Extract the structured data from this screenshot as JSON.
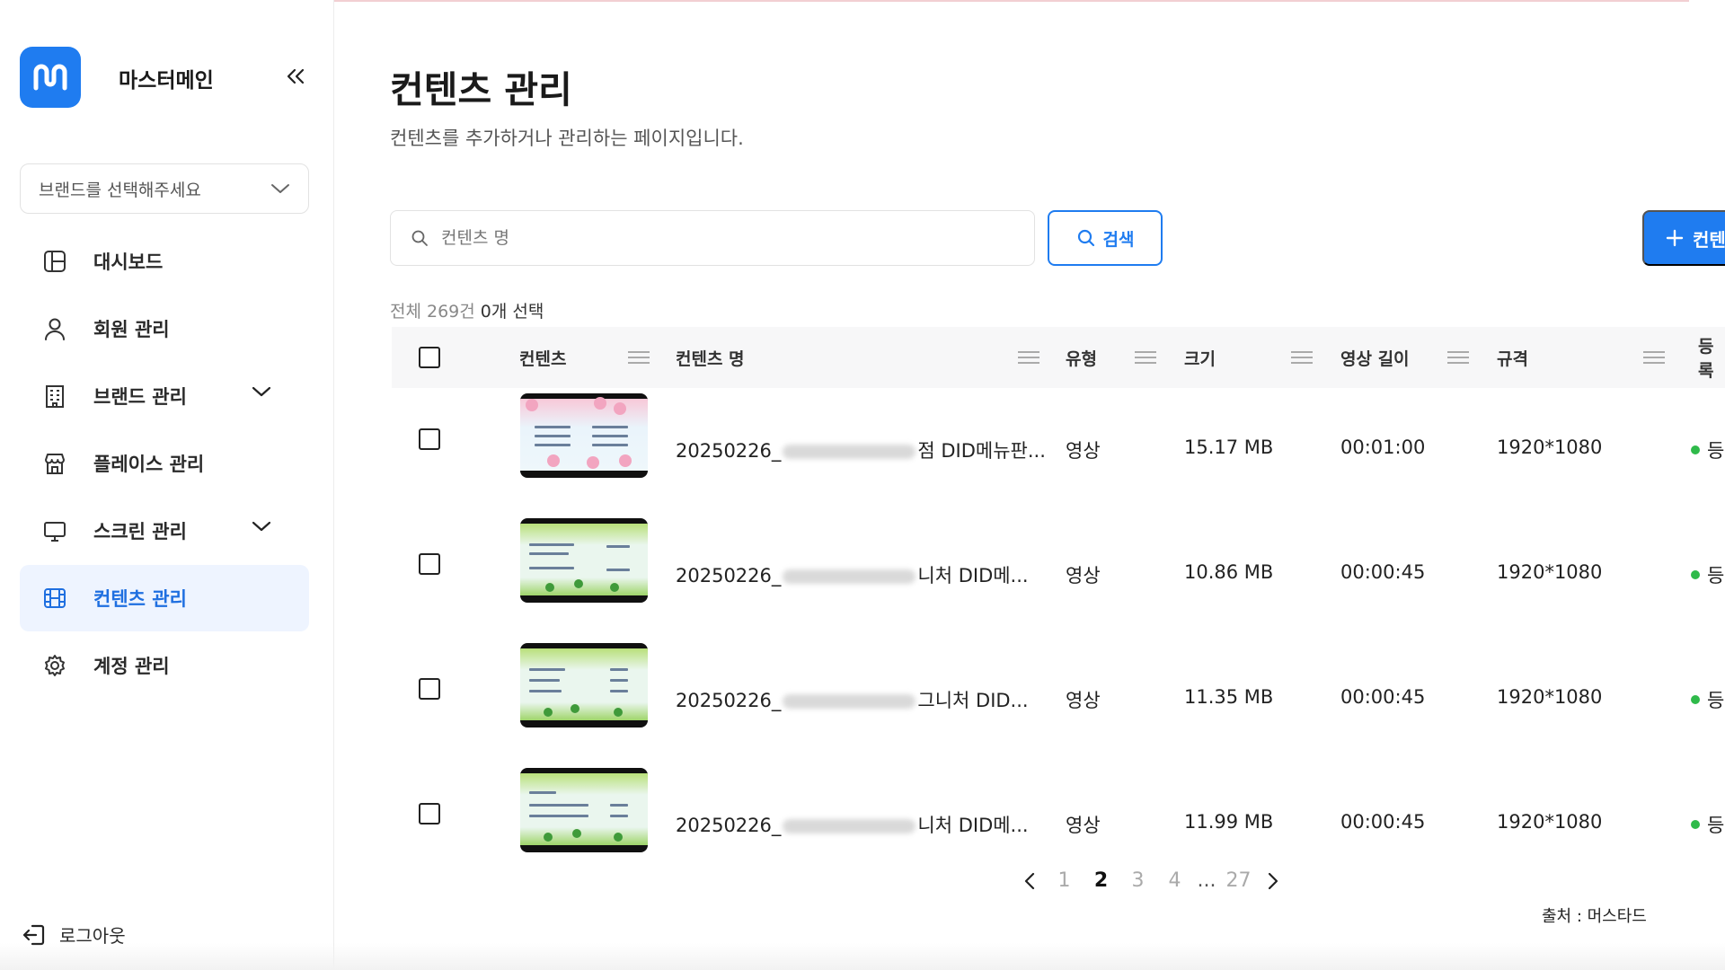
{
  "app": {
    "brand_name": "마스터메인"
  },
  "sidebar": {
    "brand_select_placeholder": "브랜드를 선택해주세요",
    "items": [
      {
        "label": "대시보드",
        "icon": "dashboard-icon",
        "expandable": false,
        "active": false
      },
      {
        "label": "회원 관리",
        "icon": "user-icon",
        "expandable": false,
        "active": false
      },
      {
        "label": "브랜드 관리",
        "icon": "building-icon",
        "expandable": true,
        "active": false
      },
      {
        "label": "플레이스 관리",
        "icon": "store-icon",
        "expandable": false,
        "active": false
      },
      {
        "label": "스크린 관리",
        "icon": "monitor-icon",
        "expandable": true,
        "active": false
      },
      {
        "label": "컨텐츠 관리",
        "icon": "film-icon",
        "expandable": false,
        "active": true
      },
      {
        "label": "계정 관리",
        "icon": "gear-icon",
        "expandable": false,
        "active": false
      }
    ],
    "logout_label": "로그아웃"
  },
  "main": {
    "title": "컨텐츠 관리",
    "description": "컨텐츠를 추가하거나 관리하는 페이지입니다.",
    "search": {
      "placeholder": "컨텐츠 명",
      "value": "",
      "button_label": "검색"
    },
    "add_button_label": "컨텐",
    "count": {
      "total_text": "전체 269건",
      "selected_text": "0개 선택"
    },
    "table": {
      "columns": [
        "컨텐츠",
        "컨텐츠 명",
        "유형",
        "크기",
        "영상 길이",
        "규격",
        "등록"
      ],
      "rows": [
        {
          "name_prefix": "20250226_",
          "name_suffix": "점 DID메뉴판...",
          "type": "영상",
          "size": "15.17 MB",
          "duration": "00:01:00",
          "resolution": "1920*1080",
          "status": "등",
          "thumb": "pink"
        },
        {
          "name_prefix": "20250226_",
          "name_suffix": "니처 DID메...",
          "type": "영상",
          "size": "10.86 MB",
          "duration": "00:00:45",
          "resolution": "1920*1080",
          "status": "등",
          "thumb": "green"
        },
        {
          "name_prefix": "20250226_",
          "name_suffix": "그니처 DID...",
          "type": "영상",
          "size": "11.35 MB",
          "duration": "00:00:45",
          "resolution": "1920*1080",
          "status": "등",
          "thumb": "green"
        },
        {
          "name_prefix": "20250226_",
          "name_suffix": "니처 DID메...",
          "type": "영상",
          "size": "11.99 MB",
          "duration": "00:00:45",
          "resolution": "1920*1080",
          "status": "등",
          "thumb": "green"
        }
      ]
    },
    "pagination": {
      "pages": [
        "1",
        "2",
        "3",
        "4"
      ],
      "current": "2",
      "ellipsis": "...",
      "last": "27"
    },
    "source_note": "출처 : 머스타드"
  },
  "colors": {
    "accent": "#1f7cf0",
    "active_bg": "#eef4ff",
    "status_green": "#2fba4a"
  }
}
